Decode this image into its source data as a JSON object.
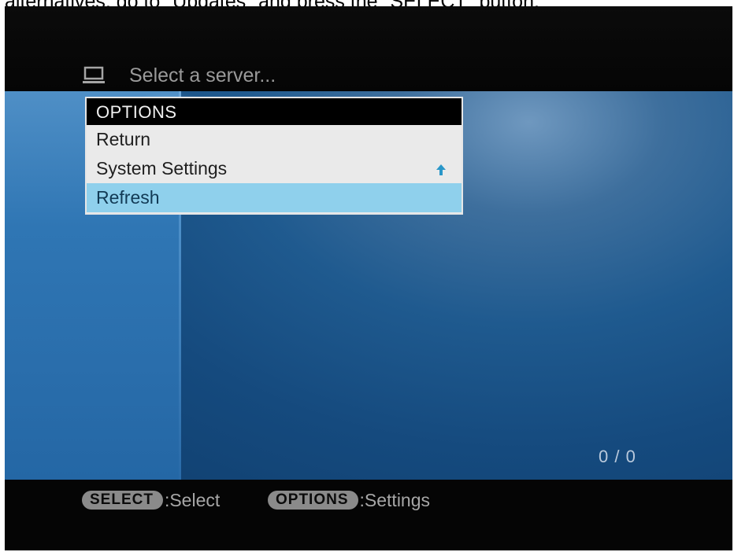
{
  "caption": "alternatives, go to \"Updates\" and press the \"SELECT\" button.",
  "header": {
    "icon": "laptop-icon",
    "title": "Select a server..."
  },
  "options_menu": {
    "title": "OPTIONS",
    "items": [
      {
        "label": "Return",
        "selected": false
      },
      {
        "label": "System Settings",
        "selected": false
      },
      {
        "label": "Refresh",
        "selected": true
      }
    ],
    "scroll_icon": "up-arrow-icon"
  },
  "status": {
    "counter": "0 / 0"
  },
  "footer": {
    "hints": [
      {
        "key": "SELECT",
        "label": ":Select"
      },
      {
        "key": "OPTIONS",
        "label": ":Settings"
      }
    ]
  },
  "colors": {
    "selection": "#8fd0ec",
    "background_blue": "#1f5a8f",
    "left_panel_blue": "#2f76b4",
    "key_badge": "#8a8a8a"
  }
}
